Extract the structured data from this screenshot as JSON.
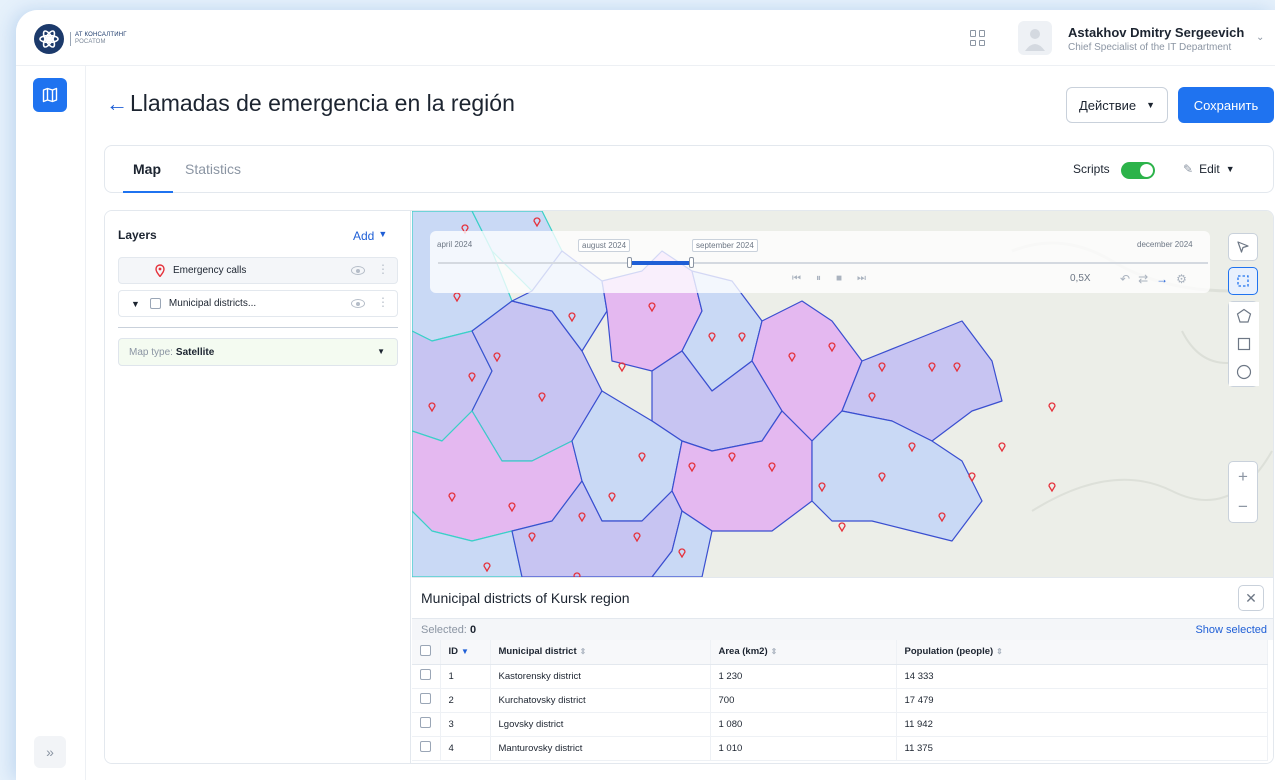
{
  "header": {
    "logo_line1": "АТ КОНСАЛТИНГ",
    "logo_line2": "РОСАТОМ",
    "user_name": "Astakhov Dmitry Sergeevich",
    "user_role": "Chief Specialist of the IT Department"
  },
  "page": {
    "title": "Llamadas de emergencia en la región",
    "action_label": "Действие",
    "save_label": "Сохранить"
  },
  "tabs": {
    "map": "Map",
    "statistics": "Statistics",
    "scripts_label": "Scripts",
    "scripts_on": true,
    "edit_label": "Edit"
  },
  "layers": {
    "title": "Layers",
    "add_label": "Add",
    "items": [
      {
        "name": "Emergency calls"
      },
      {
        "name": "Municipal districts..."
      }
    ],
    "map_type_label": "Map type:",
    "map_type_value": "Satellite"
  },
  "timeline": {
    "start": "april 2024",
    "range_start": "august 2024",
    "range_end": "september 2024",
    "end": "december 2024",
    "speed": "0,5X"
  },
  "table": {
    "title": "Municipal districts of Kursk region",
    "selected_label": "Selected:",
    "selected_count": "0",
    "show_selected": "Show selected",
    "columns": [
      "ID",
      "Municipal district",
      "Area (km2)",
      "Population (people)"
    ],
    "rows": [
      {
        "id": "1",
        "district": "Kastorensky district",
        "area": "1 230",
        "population": "14 333"
      },
      {
        "id": "2",
        "district": "Kurchatovsky district",
        "area": "700",
        "population": "17 479"
      },
      {
        "id": "3",
        "district": "Lgovsky district",
        "area": "1 080",
        "population": "11 942"
      },
      {
        "id": "4",
        "district": "Manturovsky district",
        "area": "1 010",
        "population": "11 375"
      }
    ]
  },
  "colors": {
    "accent": "#1f73f0",
    "pin": "#e5323c",
    "toggle_on": "#2cb34a",
    "district_purple": "#e4b8f0",
    "district_blue": "#c9d9f5",
    "district_violet": "#c7c4f2"
  }
}
